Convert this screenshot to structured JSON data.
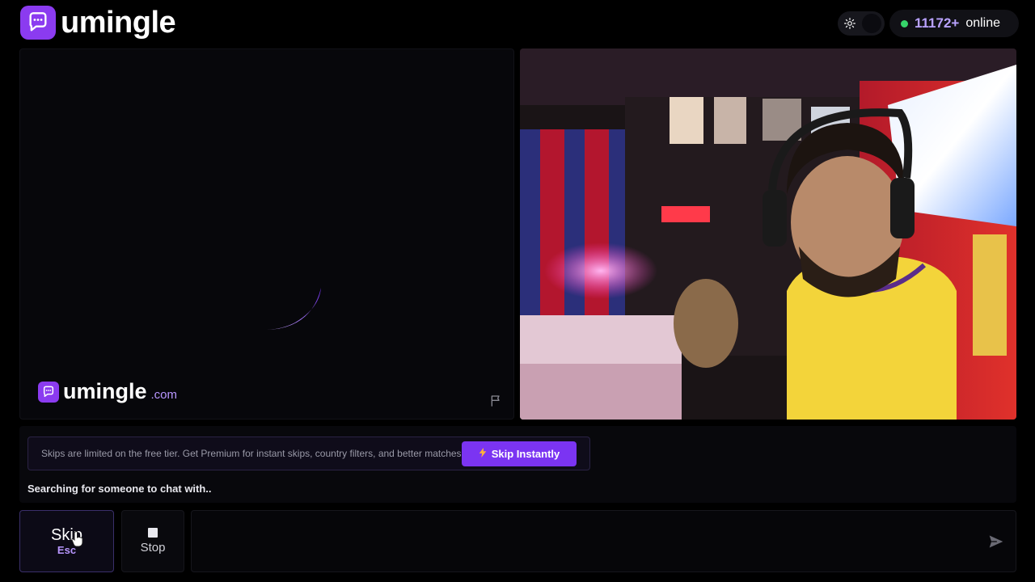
{
  "header": {
    "brand": "umingle",
    "online_count": "11172+",
    "online_label": "online"
  },
  "stranger_video": {
    "watermark_brand": "umingle",
    "watermark_suffix": ".com"
  },
  "banner": {
    "text": "Skips are limited on the free tier. Get Premium for instant skips, country filters, and better matches.",
    "button_label": "Skip Instantly"
  },
  "status": "Searching for someone to chat with..",
  "controls": {
    "skip_label": "Skip",
    "skip_key": "Esc",
    "stop_label": "Stop",
    "chat_placeholder": ""
  },
  "colors": {
    "accent": "#7b34f2",
    "brand": "#8b3bf0",
    "online_dot": "#36d46a",
    "online_count": "#b9a2ff"
  },
  "icons": {
    "logo": "chat-bubble-icon",
    "theme": "sun-icon",
    "report": "flag-icon",
    "banner_button": "lightning-icon",
    "stop": "stop-square-icon",
    "send": "send-icon"
  }
}
